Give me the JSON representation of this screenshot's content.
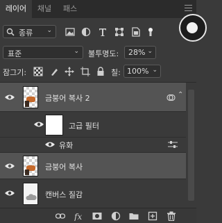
{
  "tabs": [
    {
      "label": "레이어",
      "active": true
    },
    {
      "label": "채널",
      "active": false
    },
    {
      "label": "패스",
      "active": false
    }
  ],
  "filter": {
    "kind_label": "종류",
    "icons": [
      "image-filter-icon",
      "adjustment-filter-icon",
      "type-filter-icon",
      "shape-filter-icon",
      "smart-object-filter-icon",
      "filter-toggle-icon"
    ]
  },
  "blend": {
    "mode": "표준",
    "opacity_label": "불투명도:",
    "opacity_value": "28%"
  },
  "lock": {
    "label": "잠그기:",
    "icons": [
      "lock-transparent-icon",
      "lock-image-icon",
      "lock-position-icon",
      "lock-artboard-icon",
      "lock-all-icon"
    ],
    "fill_label": "칠:",
    "fill_value": "100%"
  },
  "layers": [
    {
      "name": "금붕어 복사 2",
      "selected": true,
      "visible": true,
      "thumb": "checker",
      "has_smart_filters": true
    },
    {
      "name": "고급 필터",
      "type": "smart-filter-mask",
      "visible": true
    },
    {
      "name": "유화",
      "type": "filter-effect",
      "visible": true
    },
    {
      "name": "금붕어 복사",
      "selected": true,
      "visible": true,
      "thumb": "checker"
    },
    {
      "name": "캔버스 질감",
      "selected": false,
      "visible": true,
      "thumb": "canvas"
    }
  ],
  "bottom_icons": [
    "link-layers-icon",
    "fx-icon",
    "add-mask-icon",
    "new-adjustment-icon",
    "new-group-icon",
    "new-layer-icon",
    "delete-layer-icon"
  ],
  "colors": {
    "panel": "#3a3a3a",
    "selected_row": "#545454",
    "tab_bar": "#2b2b2b"
  }
}
